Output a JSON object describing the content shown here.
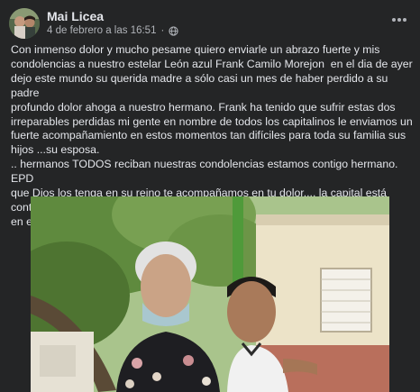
{
  "post": {
    "author": "Mai Licea",
    "timestamp": "4 de febrero a las 16:51",
    "separator": "·",
    "privacy_icon": "globe-icon",
    "more_icon": "more-horizontal-icon",
    "text": "Con inmenso dolor y mucho pesame quiero enviarle un abrazo fuerte y mis\ncondolencias a nuestro estelar León azul Frank Camilo Morejon  en el dia de ayer\ndejo este mundo su querida madre a sólo casi un mes de haber perdido a su padre\nprofundo dolor ahoga a nuestro hermano. Frank ha tenido que sufrir estas dos\nirreparables perdidas mi gente en nombre de todos los capitalinos le enviamos un\nfuerte acompañamiento en estos momentos tan difíciles para toda su familia sus\nhijos ...su esposa.\n.. hermanos TODOS reciban nuestras condolencias estamos contigo hermano. EPD\nque Dios los tenga en su reino te acompañamos en tu dolor.... la capital está contigo\nen este triste momento hermano un abrazo fuerte"
  },
  "colors": {
    "background": "#242526",
    "text_primary": "#e4e6eb",
    "text_secondary": "#b0b3b8"
  }
}
